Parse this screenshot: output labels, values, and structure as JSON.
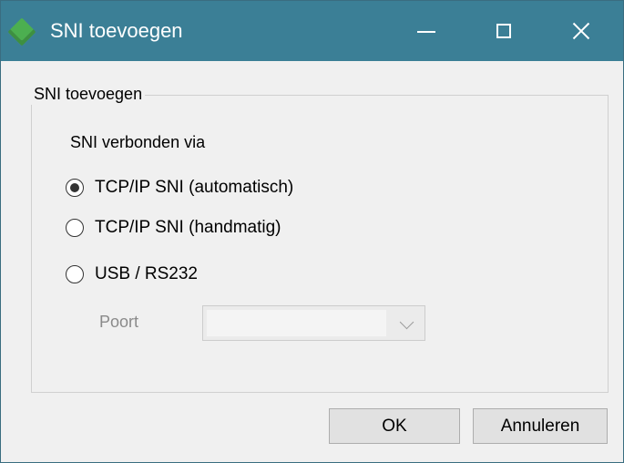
{
  "window": {
    "title": "SNI toevoegen",
    "icon": "green-diamond-icon",
    "controls": {
      "minimize": "minimize-icon",
      "maximize": "maximize-icon",
      "close": "close-icon"
    }
  },
  "group": {
    "legend": "SNI toevoegen",
    "connection_label": "SNI verbonden via",
    "options": [
      {
        "label": "TCP/IP SNI (automatisch)",
        "selected": true
      },
      {
        "label": "TCP/IP SNI (handmatig)",
        "selected": false
      },
      {
        "label": "USB / RS232",
        "selected": false
      }
    ],
    "port": {
      "label": "Poort",
      "value": "",
      "enabled": false
    }
  },
  "buttons": {
    "ok": "OK",
    "cancel": "Annuleren"
  },
  "colors": {
    "titlebar": "#3b7f96",
    "background": "#f0f0f0",
    "icon_green": "#4caf50",
    "disabled_text": "#8a8a8a"
  }
}
